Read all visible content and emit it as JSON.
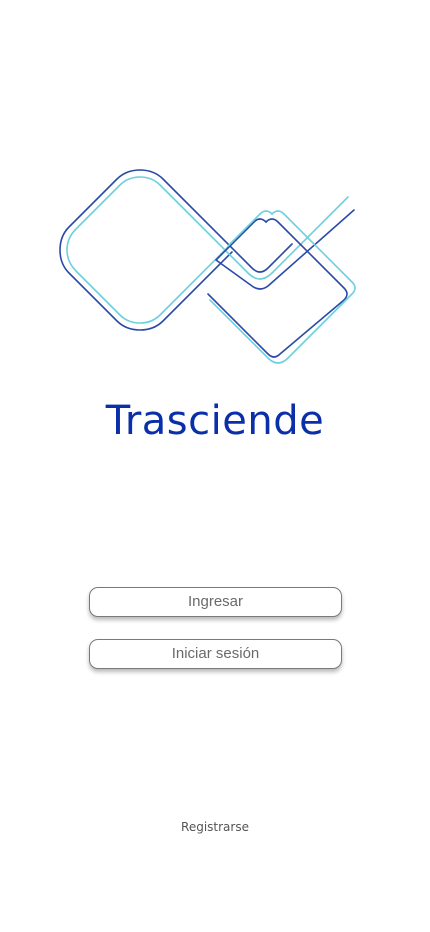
{
  "brand": {
    "title": "Trasciende",
    "logo_icon": "interlocked-diamonds-logo-icon",
    "colors": {
      "title": "#0a2fa8",
      "logo_dark": "#2b4aa8",
      "logo_light": "#6dd0de"
    }
  },
  "actions": {
    "ingresar_label": "Ingresar",
    "iniciar_sesion_label": "Iniciar sesión",
    "registrarse_label": "Registrarse"
  }
}
